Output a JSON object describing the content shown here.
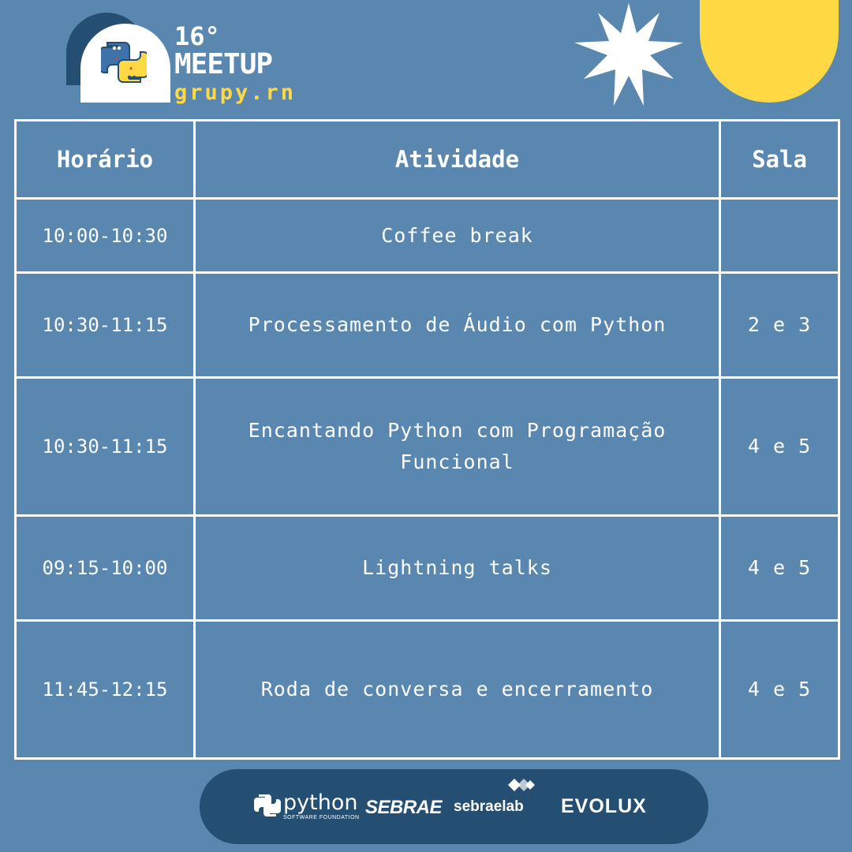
{
  "header": {
    "edition": "16°",
    "event": "MEETUP",
    "group": "grupy.rn"
  },
  "colors": {
    "background": "#5a87b0",
    "dark_accent": "#244e72",
    "yellow_accent": "#ffd943",
    "python_blue": "#3f72a8",
    "python_yellow": "#ffd943"
  },
  "icons": [
    "python-logo-icon",
    "starburst-icon",
    "half-sun-shape",
    "python-psf-logo",
    "sebraelab-logo-icon"
  ],
  "table": {
    "headers": {
      "time": "Horário",
      "activity": "Atividade",
      "room": "Sala"
    },
    "rows": [
      {
        "time": "10:00-10:30",
        "activity": "Coffee break",
        "room": ""
      },
      {
        "time": "10:30-11:15",
        "activity": "Processamento de Áudio com Python",
        "room": "2 e 3"
      },
      {
        "time": "10:30-11:15",
        "activity": "Encantando Python com Programação Funcional",
        "room": "4 e 5"
      },
      {
        "time": "09:15-10:00",
        "activity": "Lightning talks",
        "room": "4 e 5"
      },
      {
        "time": "11:45-12:15",
        "activity": "Roda de conversa e encerramento",
        "room": "4 e 5"
      }
    ]
  },
  "sponsors": {
    "python_word": "python",
    "python_sub": "SOFTWARE FOUNDATION",
    "sebrae": "SEBRAE",
    "sebraelab": "sebraelab",
    "evolux": "EVOLUX"
  }
}
